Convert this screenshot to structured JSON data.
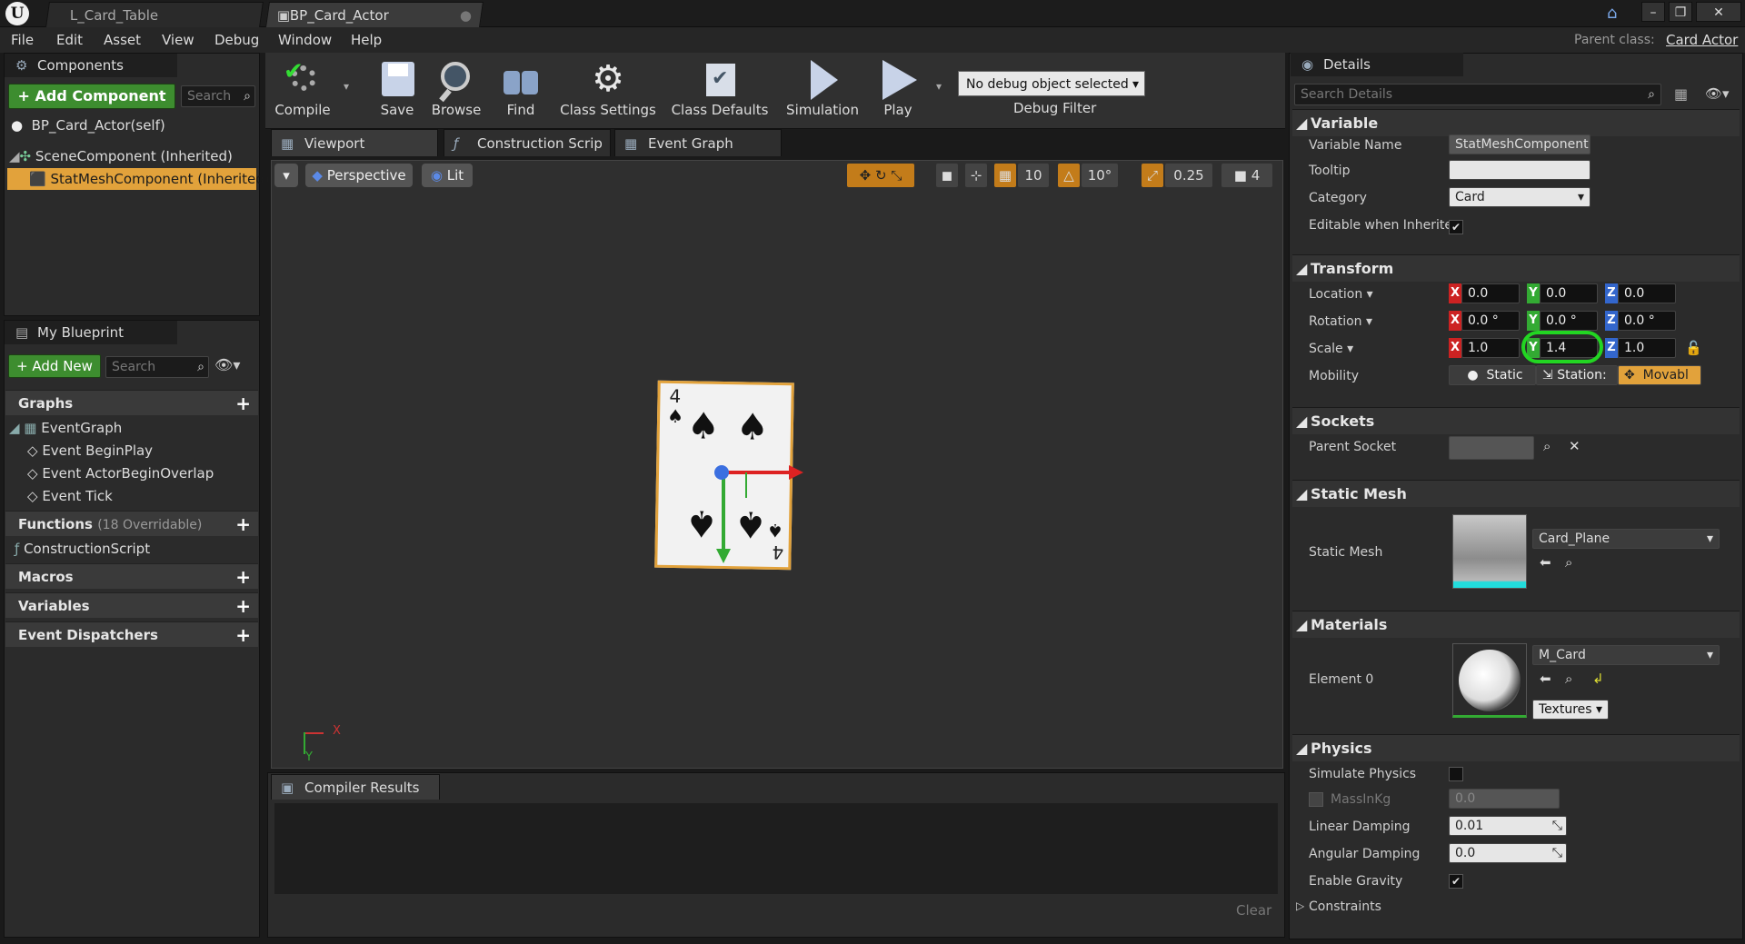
{
  "tabs": [
    {
      "label": "L_Card_Table"
    },
    {
      "label": "BP_Card_Actor"
    }
  ],
  "menu": [
    "File",
    "Edit",
    "Asset",
    "View",
    "Debug",
    "Window",
    "Help"
  ],
  "parent_class": {
    "label": "Parent class:",
    "value": "Card Actor"
  },
  "components": {
    "title": "Components",
    "add_label": "+ Add Component",
    "search_placeholder": "Search",
    "items": [
      "BP_Card_Actor(self)",
      "SceneComponent (Inherited)",
      "StatMeshComponent (Inherited)"
    ]
  },
  "blueprint": {
    "title": "My Blueprint",
    "add_label": "+ Add New",
    "search_placeholder": "Search",
    "graphs_label": "Graphs",
    "event_graph": "EventGraph",
    "events": [
      "Event BeginPlay",
      "Event ActorBeginOverlap",
      "Event Tick"
    ],
    "functions_label": "Functions",
    "functions_count": "(18 Overridable)",
    "construction_script": "ConstructionScript",
    "macros": "Macros",
    "variables": "Variables",
    "dispatchers": "Event Dispatchers"
  },
  "toolbar": {
    "compile": "Compile",
    "save": "Save",
    "browse": "Browse",
    "find": "Find",
    "class_settings": "Class Settings",
    "class_defaults": "Class Defaults",
    "simulation": "Simulation",
    "play": "Play",
    "debug_object": "No debug object selected",
    "debug_filter": "Debug Filter"
  },
  "editor_tabs": [
    "Viewport",
    "Construction Scrip",
    "Event Graph"
  ],
  "viewport": {
    "perspective": "Perspective",
    "lit": "Lit",
    "grid_snap": "10",
    "rot_snap": "10°",
    "scale_snap": "0.25",
    "cam_speed": "4",
    "card_rank": "4",
    "axis_x": "X",
    "axis_y": "Y"
  },
  "compiler": {
    "title": "Compiler Results",
    "clear": "Clear"
  },
  "details": {
    "title": "Details",
    "search_placeholder": "Search Details",
    "variable": {
      "header": "Variable",
      "name_label": "Variable Name",
      "name_value": "StatMeshComponent",
      "tooltip_label": "Tooltip",
      "category_label": "Category",
      "category_value": "Card",
      "editable_label": "Editable when Inherite"
    },
    "transform": {
      "header": "Transform",
      "location_label": "Location",
      "location": [
        "0.0",
        "0.0",
        "0.0"
      ],
      "rotation_label": "Rotation",
      "rotation": [
        "0.0 °",
        "0.0 °",
        "0.0 °"
      ],
      "scale_label": "Scale",
      "scale": [
        "1.0",
        "1.4",
        "1.0"
      ],
      "mobility_label": "Mobility",
      "mobility": [
        "Static",
        "Station:",
        "Movabl"
      ]
    },
    "sockets": {
      "header": "Sockets",
      "parent_label": "Parent Socket"
    },
    "static_mesh": {
      "header": "Static Mesh",
      "label": "Static Mesh",
      "value": "Card_Plane"
    },
    "materials": {
      "header": "Materials",
      "label": "Element 0",
      "value": "M_Card",
      "textures": "Textures"
    },
    "physics": {
      "header": "Physics",
      "simulate": "Simulate Physics",
      "mass": "MassInKg",
      "mass_value": "0.0",
      "linear": "Linear Damping",
      "linear_value": "0.01",
      "angular": "Angular Damping",
      "angular_value": "0.0",
      "gravity": "Enable Gravity",
      "constraints": "Constraints"
    }
  },
  "colors": {
    "accent_green": "#3d8d2f",
    "selection": "#e2a23b",
    "highlight_circle": "#22d622"
  }
}
